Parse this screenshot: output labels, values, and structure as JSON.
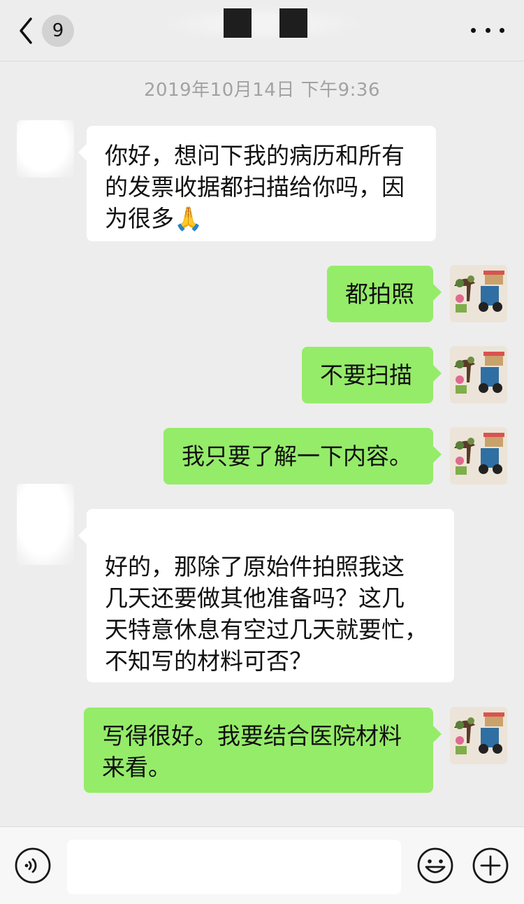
{
  "header": {
    "unread_count": "9",
    "back_icon": "chevron-left-icon",
    "more_icon": "more-dots-icon"
  },
  "timestamp": "2019年10月14日 下午9:36",
  "messages": [
    {
      "from": "other",
      "text": "你好，想问下我的病历和所有\n的发票收据都扫描给你吗，因\n为很多🙏"
    },
    {
      "from": "self",
      "text": "都拍照"
    },
    {
      "from": "self",
      "text": "不要扫描"
    },
    {
      "from": "self",
      "text": "我只要了解一下内容。"
    },
    {
      "from": "other",
      "text": "好的，那除了原始件拍照我这\n几天还要做其他准备吗？这几\n天特意休息有空过几天就要忙，\n不知写的材料可否？"
    },
    {
      "from": "self",
      "text": "写得很好。我要结合医院材料\n来看。"
    }
  ],
  "input_bar": {
    "voice_icon": "voice-icon",
    "emoji_icon": "emoji-icon",
    "add_icon": "plus-icon",
    "input_value": ""
  },
  "colors": {
    "background": "#ededed",
    "incoming_bubble": "#ffffff",
    "outgoing_bubble": "#95ec69",
    "timestamp_text": "#a2a2a2"
  }
}
